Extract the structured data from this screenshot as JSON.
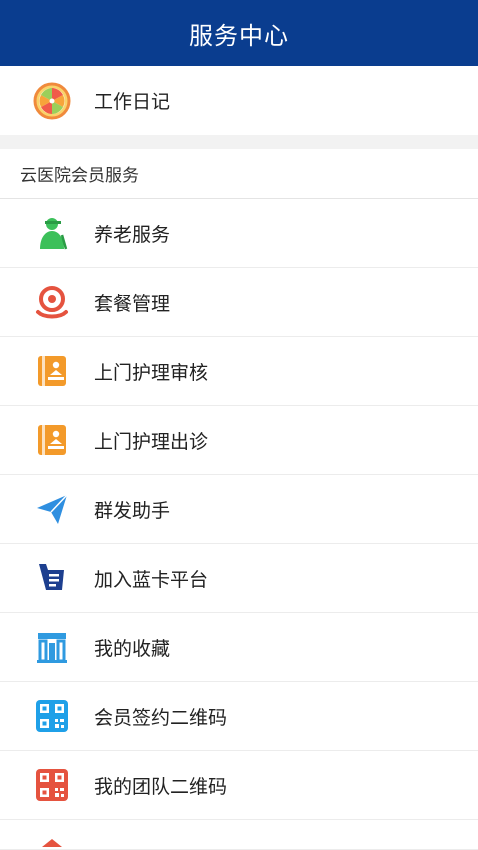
{
  "header": {
    "title": "服务中心"
  },
  "top_item": {
    "label": "工作日记",
    "icon": "orange-slice-icon"
  },
  "section": {
    "title": "云医院会员服务"
  },
  "items": [
    {
      "label": "养老服务",
      "icon": "elder-care-icon",
      "color": "#3cc05a"
    },
    {
      "label": "套餐管理",
      "icon": "package-gear-icon",
      "color": "#e5533f"
    },
    {
      "label": "上门护理审核",
      "icon": "home-nursing-icon",
      "color": "#f39a2a"
    },
    {
      "label": "上门护理出诊",
      "icon": "home-nursing-visit-icon",
      "color": "#f39a2a"
    },
    {
      "label": "群发助手",
      "icon": "send-icon",
      "color": "#2f8fe0"
    },
    {
      "label": "加入蓝卡平台",
      "icon": "blue-card-icon",
      "color": "#1d3f8f"
    },
    {
      "label": "我的收藏",
      "icon": "collection-building-icon",
      "color": "#2f9ae0"
    },
    {
      "label": "会员签约二维码",
      "icon": "qr-code-icon",
      "color": "#1fa0e8"
    },
    {
      "label": "我的团队二维码",
      "icon": "team-qr-code-icon",
      "color": "#e5533f"
    }
  ]
}
